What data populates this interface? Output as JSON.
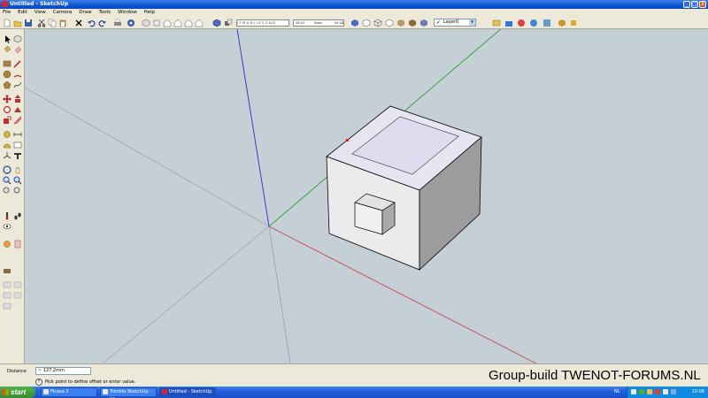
{
  "window": {
    "title": "Untitled - SketchUp",
    "controls": [
      "_",
      "□",
      "X"
    ]
  },
  "menu": [
    "File",
    "Edit",
    "View",
    "Camera",
    "Draw",
    "Tools",
    "Window",
    "Help"
  ],
  "toolbar": {
    "shadow_months": "J  F  M  A  M  J  J  A  S  O  N  D",
    "time_start": "06:43",
    "time_noon": "Noon",
    "time_end": "04:46",
    "layer_name": "Layer0",
    "layer_checked": "✓"
  },
  "status": {
    "distance_label": "Distance",
    "distance_value": "~ 127,2mm",
    "hint_icon": "?",
    "hint_text": "Pick point to define offset or enter value."
  },
  "watermark": "Group-build TWENOT-FORUMS.NL",
  "taskbar": {
    "start_label": "start",
    "tasks": [
      "Picasa 3",
      "Trimble SketchUp - Wi...",
      "Untitled - SketchUp"
    ],
    "lang": "NL",
    "clock": "10:08"
  },
  "colors": {
    "axis_red": "#c8484a",
    "axis_green": "#2ea02e",
    "axis_blue": "#3a3ad0",
    "viewport_bg": "#c5d0d6",
    "face_top": "#e6e6f2",
    "face_left": "#ebebeb",
    "face_right": "#9c9c9c"
  }
}
